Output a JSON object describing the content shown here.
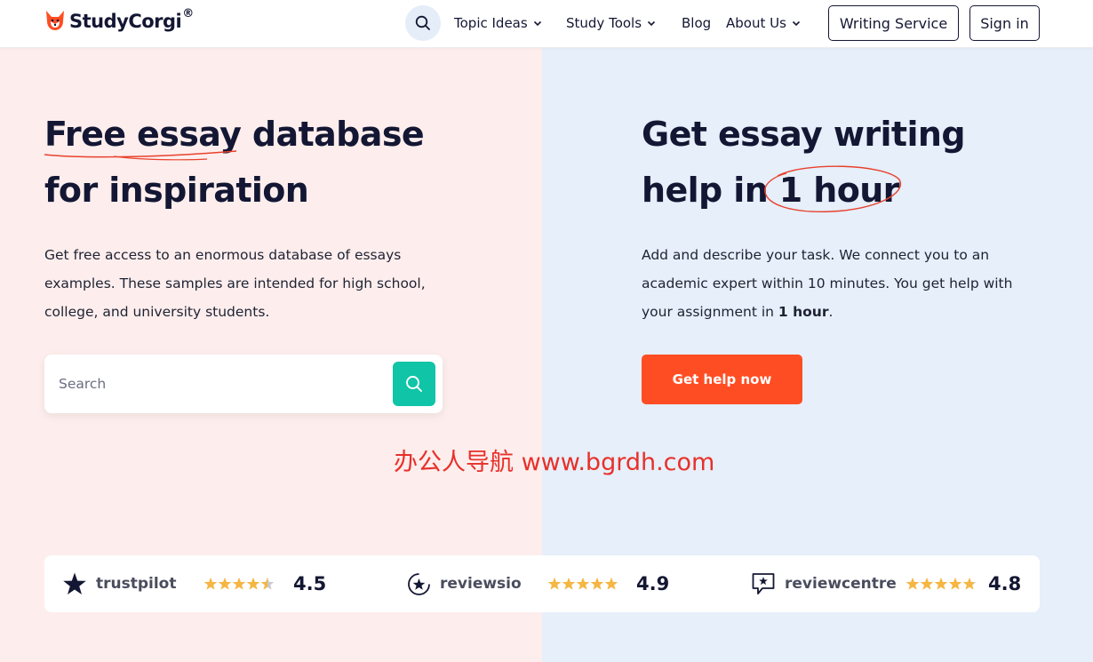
{
  "header": {
    "logo_text": "StudyCorgi",
    "logo_reg": "®",
    "nav": [
      {
        "label": "Topic Ideas",
        "has_dropdown": true
      },
      {
        "label": "Study Tools",
        "has_dropdown": true
      },
      {
        "label": "Blog",
        "has_dropdown": false
      },
      {
        "label": "About Us",
        "has_dropdown": true
      }
    ],
    "writing_service_label": "Writing Service",
    "sign_in_label": "Sign in"
  },
  "left": {
    "title_line1_part1": "Free essay",
    "title_line1_part2": " database",
    "title_line2": "for inspiration",
    "description": "Get free access to an enormous database of essays examples. These samples are intended for high school, college, and university students.",
    "search_placeholder": "Search"
  },
  "right": {
    "title_line1": "Get essay writing",
    "title_line2_part1": "help in ",
    "title_line2_part2": "1 hour",
    "description_part1": "Add and describe your task. We connect you to an academic expert within 10 minutes. You get help with your assignment in ",
    "description_bold": "1 hour",
    "description_part2": ".",
    "cta_label": "Get help now"
  },
  "watermark": "办公人导航  www.bgrdh.com",
  "reviews": [
    {
      "name": "trustpilot",
      "rating": 4.5,
      "score_text": "4.5",
      "icon": "trustpilot-star-icon"
    },
    {
      "name": "reviewsio",
      "rating": 4.9,
      "score_text": "4.9",
      "icon": "reviewsio-icon"
    },
    {
      "name": "reviewcentre",
      "rating": 4.8,
      "score_text": "4.8",
      "icon": "reviewcentre-icon"
    }
  ],
  "colors": {
    "navy": "#141733",
    "accent_orange": "#ff4d23",
    "teal": "#0fc4a7",
    "star_yellow": "#f5b642",
    "left_bg": "#fdeeed",
    "right_bg": "#e6effa",
    "annotation_red": "#e8412c"
  }
}
